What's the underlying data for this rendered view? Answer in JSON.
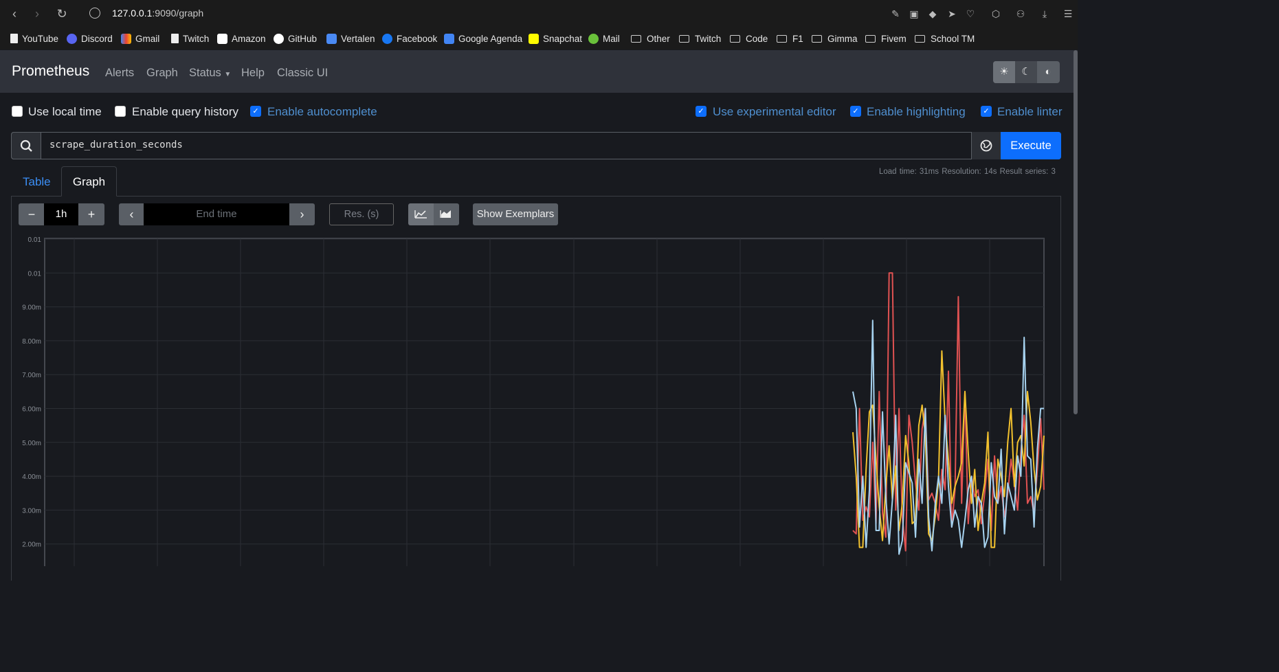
{
  "browser": {
    "url_host": "127.0.0.1",
    "url_rest": ":9090/graph",
    "bookmarks": [
      "YouTube",
      "Discord",
      "Gmail",
      "Twitch",
      "Amazon",
      "GitHub",
      "Vertalen",
      "Facebook",
      "Google Agenda",
      "Snapchat",
      "Mail",
      "Other",
      "Twitch",
      "Code",
      "F1",
      "Gimma",
      "Fivem",
      "School TM"
    ]
  },
  "nav": {
    "brand": "Prometheus",
    "links": [
      "Alerts",
      "Graph",
      "Status",
      "Help",
      "Classic UI"
    ]
  },
  "options": {
    "use_local_time": "Use local time",
    "enable_query_history": "Enable query history",
    "enable_autocomplete": "Enable autocomplete",
    "use_experimental_editor": "Use experimental editor",
    "enable_highlighting": "Enable highlighting",
    "enable_linter": "Enable linter"
  },
  "query": {
    "expression": "scrape_duration_seconds",
    "execute_label": "Execute"
  },
  "tabs": {
    "table": "Table",
    "graph": "Graph"
  },
  "meta": {
    "text": "Load time: 31ms   Resolution: 14s   Result series: 3"
  },
  "controls": {
    "range": "1h",
    "end_time_placeholder": "End time",
    "resolution_placeholder": "Res. (s)",
    "show_exemplars": "Show Exemplars"
  },
  "chart_data": {
    "type": "line",
    "y_ticks": [
      "0.01",
      "0.01",
      "9.00m",
      "8.00m",
      "7.00m",
      "6.00m",
      "5.00m",
      "4.00m",
      "3.00m",
      "2.00m"
    ],
    "ylim": [
      0.0016,
      0.011
    ],
    "grid": true,
    "series": [
      {
        "color": "#e05252",
        "values": [
          2.4,
          2.3,
          6.0,
          2.7,
          3.1,
          2.8,
          5.0,
          2.6,
          6.5,
          2.9,
          2.2,
          10.0,
          10.0,
          3.0,
          6.0,
          2.8,
          1.8,
          5.8,
          5.0,
          3.8,
          3.0,
          5.4,
          6.0,
          3.3,
          3.5,
          3.2,
          2.7,
          4.2,
          3.6,
          7.1,
          2.5,
          3.6,
          9.3,
          3.2,
          6.5,
          2.6,
          4.0,
          3.4,
          3.6,
          2.6,
          3.5,
          4.5,
          2.4,
          4.6,
          3.2,
          3.7,
          2.8,
          3.5,
          4.5,
          3.8,
          3.0,
          4.7,
          5.8,
          3.2,
          3.4,
          2.9,
          4.2,
          5.7,
          3.6
        ]
      },
      {
        "color": "#f2c12e",
        "values": [
          5.3,
          4.0,
          1.9,
          1.9,
          4.2,
          5.9,
          6.1,
          4.5,
          3.1,
          2.1,
          3.7,
          4.9,
          3.3,
          4.3,
          2.4,
          3.2,
          5.2,
          4.4,
          2.6,
          2.7,
          5.5,
          6.1,
          5.2,
          2.3,
          2.1,
          2.8,
          3.9,
          7.7,
          5.6,
          4.5,
          3.2,
          3.7,
          4.0,
          4.4,
          6.5,
          4.7,
          3.2,
          4.2,
          2.4,
          3.2,
          3.8,
          5.3,
          1.9,
          1.9,
          4.5,
          4.0,
          3.4,
          5.0,
          6.0,
          3.7,
          5.0,
          5.2,
          4.3,
          6.5,
          5.6,
          4.2,
          3.3,
          3.7,
          5.2
        ]
      },
      {
        "color": "#a6d2ef",
        "values": [
          6.5,
          6.0,
          2.5,
          4.0,
          1.9,
          3.6,
          8.6,
          2.4,
          2.4,
          5.9,
          3.4,
          2.0,
          3.3,
          5.8,
          1.7,
          2.1,
          4.4,
          4.1,
          3.8,
          2.2,
          4.5,
          3.2,
          6.0,
          2.8,
          1.8,
          3.2,
          4.0,
          3.2,
          5.8,
          3.7,
          2.5,
          3.0,
          2.7,
          1.9,
          2.7,
          3.6,
          4.0,
          2.5,
          3.4,
          3.2,
          1.9,
          2.2,
          4.4,
          3.4,
          3.2,
          4.8,
          2.3,
          3.8,
          3.4,
          3.0,
          4.6,
          4.0,
          8.1,
          4.6,
          4.5,
          2.5,
          4.8,
          6.0,
          6.0
        ]
      }
    ]
  }
}
